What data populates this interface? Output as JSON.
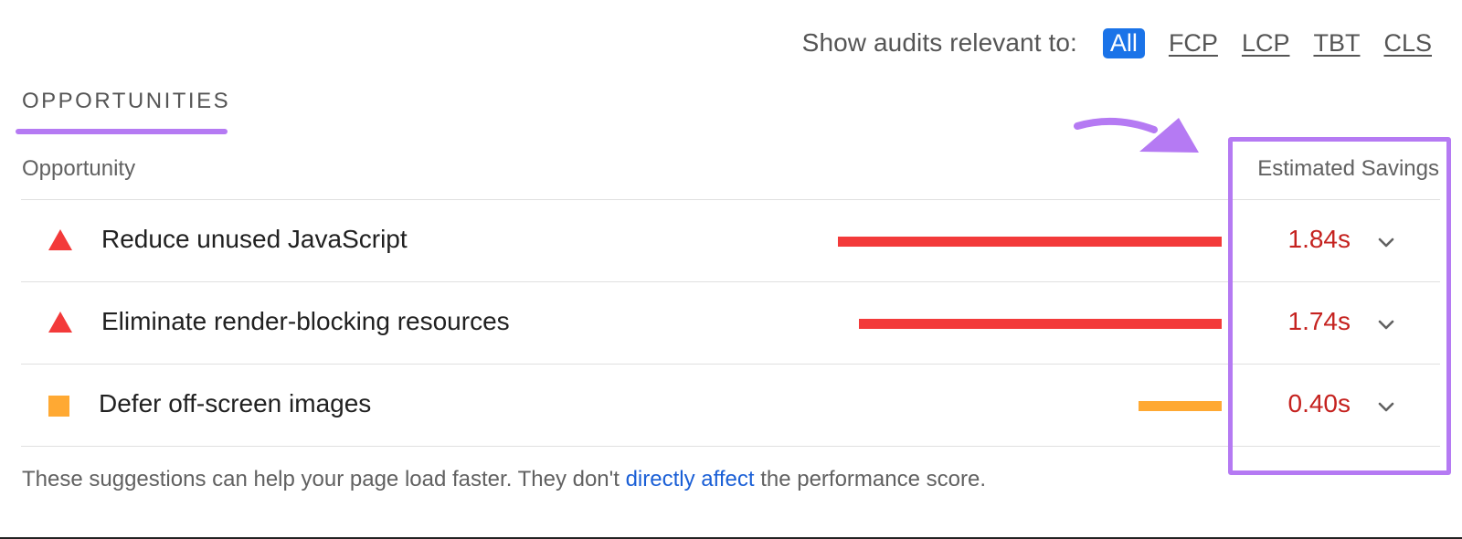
{
  "filter": {
    "label": "Show audits relevant to:",
    "options": [
      "All",
      "FCP",
      "LCP",
      "TBT",
      "CLS"
    ],
    "active": "All"
  },
  "section": {
    "title": "OPPORTUNITIES"
  },
  "table": {
    "col_opportunity": "Opportunity",
    "col_savings": "Estimated Savings",
    "rows": [
      {
        "icon": "fail-triangle-icon",
        "title": "Reduce unused JavaScript",
        "savings": "1.84s",
        "savings_seconds": 1.84,
        "bar_color": "#f33a3a"
      },
      {
        "icon": "fail-triangle-icon",
        "title": "Eliminate render-blocking resources",
        "savings": "1.74s",
        "savings_seconds": 1.74,
        "bar_color": "#f33a3a"
      },
      {
        "icon": "average-square-icon",
        "title": "Defer off-screen images",
        "savings": "0.40s",
        "savings_seconds": 0.4,
        "bar_color": "#ffa933"
      }
    ]
  },
  "footer": {
    "text_before": "These suggestions can help your page load faster. They don't ",
    "link_text": "directly affect",
    "text_after": " the performance score."
  },
  "colors": {
    "accent_purple": "#b57af3",
    "active_chip": "#1a73e8",
    "fail_red": "#f33a3a",
    "average_orange": "#ffa933",
    "savings_text": "#c5221f",
    "link_blue": "#1a5fd6"
  }
}
